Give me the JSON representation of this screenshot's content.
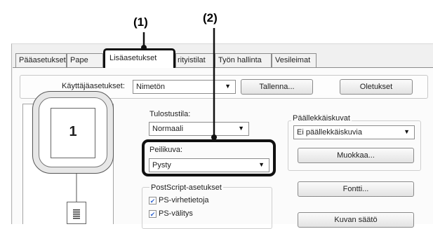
{
  "callouts": {
    "one": "(1)",
    "two": "(2)"
  },
  "tabs": [
    {
      "label": "Pääasetukset"
    },
    {
      "label": "Pape"
    },
    {
      "label": "Lisäasetukset"
    },
    {
      "label": "rityistilat"
    },
    {
      "label": "Työn hallinta"
    },
    {
      "label": "Vesileimat"
    }
  ],
  "user_settings": {
    "label": "Käyttäjäasetukset:",
    "value": "Nimetön",
    "save_label": "Tallenna...",
    "defaults_label": "Oletukset"
  },
  "print_mode": {
    "label": "Tulostustila:",
    "value": "Normaali"
  },
  "mirror": {
    "label": "Peilikuva:",
    "value": "Pysty"
  },
  "postscript": {
    "label": "PostScript-asetukset",
    "options": [
      {
        "label": "PS-virhetietoja",
        "checked": true
      },
      {
        "label": "PS-välitys",
        "checked": true
      }
    ]
  },
  "overlays": {
    "label": "Päällekkäiskuvat",
    "value": "Ei päällekkäiskuvia",
    "edit_label": "Muokkaa..."
  },
  "font_label": "Fontti...",
  "image_adjust_label": "Kuvan säätö",
  "preview": {
    "page_number": "1"
  }
}
